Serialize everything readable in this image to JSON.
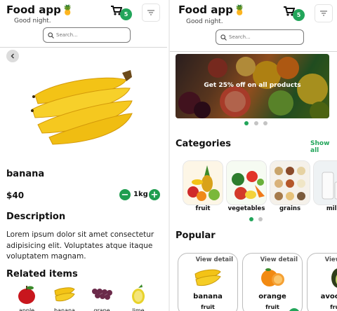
{
  "header": {
    "app_title": "Food app",
    "greeting": "Good night.",
    "cart_count": "5",
    "search_placeholder": "Search..."
  },
  "detail": {
    "name": "banana",
    "price": "$40",
    "quantity": "1kg",
    "minus": "−",
    "plus": "+",
    "description_heading": "Description",
    "description": "Lorem ipsum dolor sit amet consectetur adipisicing elit. Voluptates atque itaque voluptatem magnam.",
    "related_heading": "Related items",
    "related": [
      "apple",
      "banana",
      "grape",
      "lime"
    ]
  },
  "home": {
    "banner_text": "Get 25% off on all products",
    "categories_heading": "Categories",
    "show_all": "Show all",
    "categories": [
      "fruit",
      "vegetables",
      "grains",
      "milk"
    ],
    "popular_heading": "Popular",
    "popular": [
      {
        "view": "View detail",
        "name": "banana",
        "category": "fruit"
      },
      {
        "view": "View detail",
        "name": "orange",
        "category": "fruit"
      },
      {
        "view": "View detail",
        "name": "avocado",
        "category": "fruit"
      }
    ]
  },
  "colors": {
    "accent": "#22a55a",
    "badge": "#22a55a",
    "text": "#111111"
  }
}
